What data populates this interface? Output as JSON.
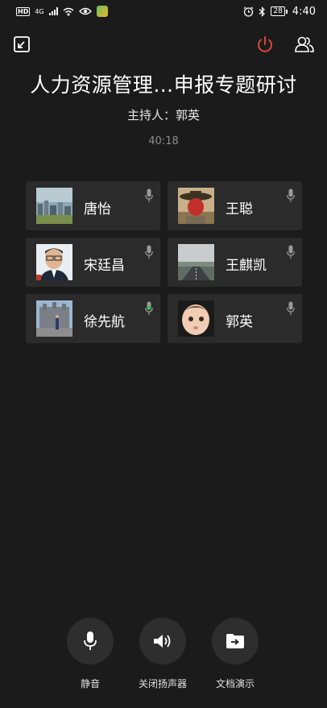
{
  "status_bar": {
    "hd": "HD",
    "network": "4G",
    "battery": "28",
    "time": "4:40"
  },
  "meeting": {
    "title": "人力资源管理…申报专题研讨",
    "host": "主持人：郭英",
    "timer": "40:18"
  },
  "participants": [
    {
      "name": "唐怡",
      "avatar": "city-photo-avatar",
      "mic": "inactive"
    },
    {
      "name": "王聪",
      "avatar": "hat-person-avatar",
      "mic": "inactive"
    },
    {
      "name": "宋廷昌",
      "avatar": "man-glasses-avatar",
      "mic": "inactive"
    },
    {
      "name": "王麒凯",
      "avatar": "road-landscape-avatar",
      "mic": "inactive"
    },
    {
      "name": "徐先航",
      "avatar": "building-photo-avatar",
      "mic": "active"
    },
    {
      "name": "郭英",
      "avatar": "baby-avatar",
      "mic": "inactive"
    }
  ],
  "controls": {
    "mute": "静音",
    "speaker": "关闭扬声器",
    "doc": "文档演示"
  },
  "colors": {
    "background": "#1b1b1b",
    "card": "#2b2b2b",
    "end_call": "#e0453a",
    "mic_active": "#3dbf5a",
    "mic_inactive": "#9a9a9a"
  }
}
